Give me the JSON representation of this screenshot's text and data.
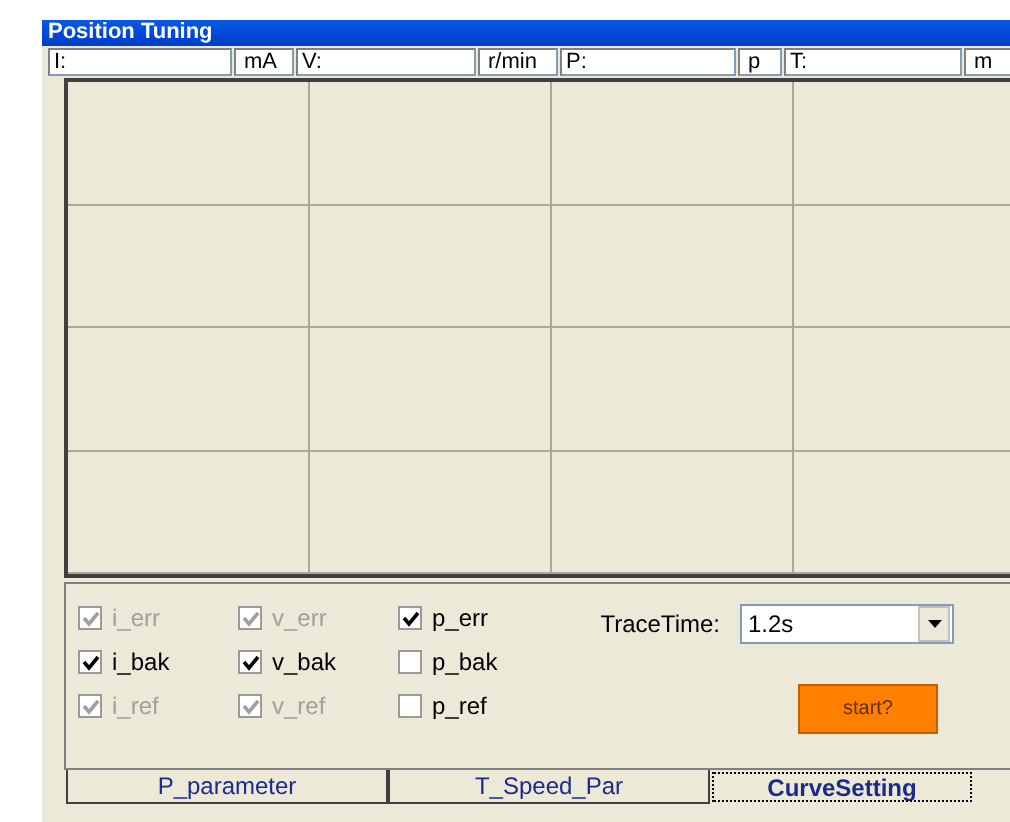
{
  "window": {
    "title": "Position Tuning"
  },
  "readouts": [
    {
      "label": "I:",
      "unit": "mA"
    },
    {
      "label": "V:",
      "unit": "r/min"
    },
    {
      "label": "P:",
      "unit": "p"
    },
    {
      "label": "T:",
      "unit": "m"
    }
  ],
  "checkboxes": [
    {
      "label": "i_err",
      "checked": true,
      "disabled": true
    },
    {
      "label": "v_err",
      "checked": true,
      "disabled": true
    },
    {
      "label": "p_err",
      "checked": true,
      "disabled": false
    },
    {
      "label": "i_bak",
      "checked": true,
      "disabled": false
    },
    {
      "label": "v_bak",
      "checked": true,
      "disabled": false
    },
    {
      "label": "p_bak",
      "checked": false,
      "disabled": false
    },
    {
      "label": "i_ref",
      "checked": true,
      "disabled": true
    },
    {
      "label": "v_ref",
      "checked": true,
      "disabled": true
    },
    {
      "label": "p_ref",
      "checked": false,
      "disabled": false
    }
  ],
  "trace_time": {
    "label": "TraceTime:",
    "value": "1.2s"
  },
  "start_button": "start?",
  "tabs": [
    {
      "label": "P_parameter",
      "selected": false
    },
    {
      "label": "T_Speed_Par",
      "selected": false
    },
    {
      "label": "CurveSetting",
      "selected": true
    }
  ]
}
